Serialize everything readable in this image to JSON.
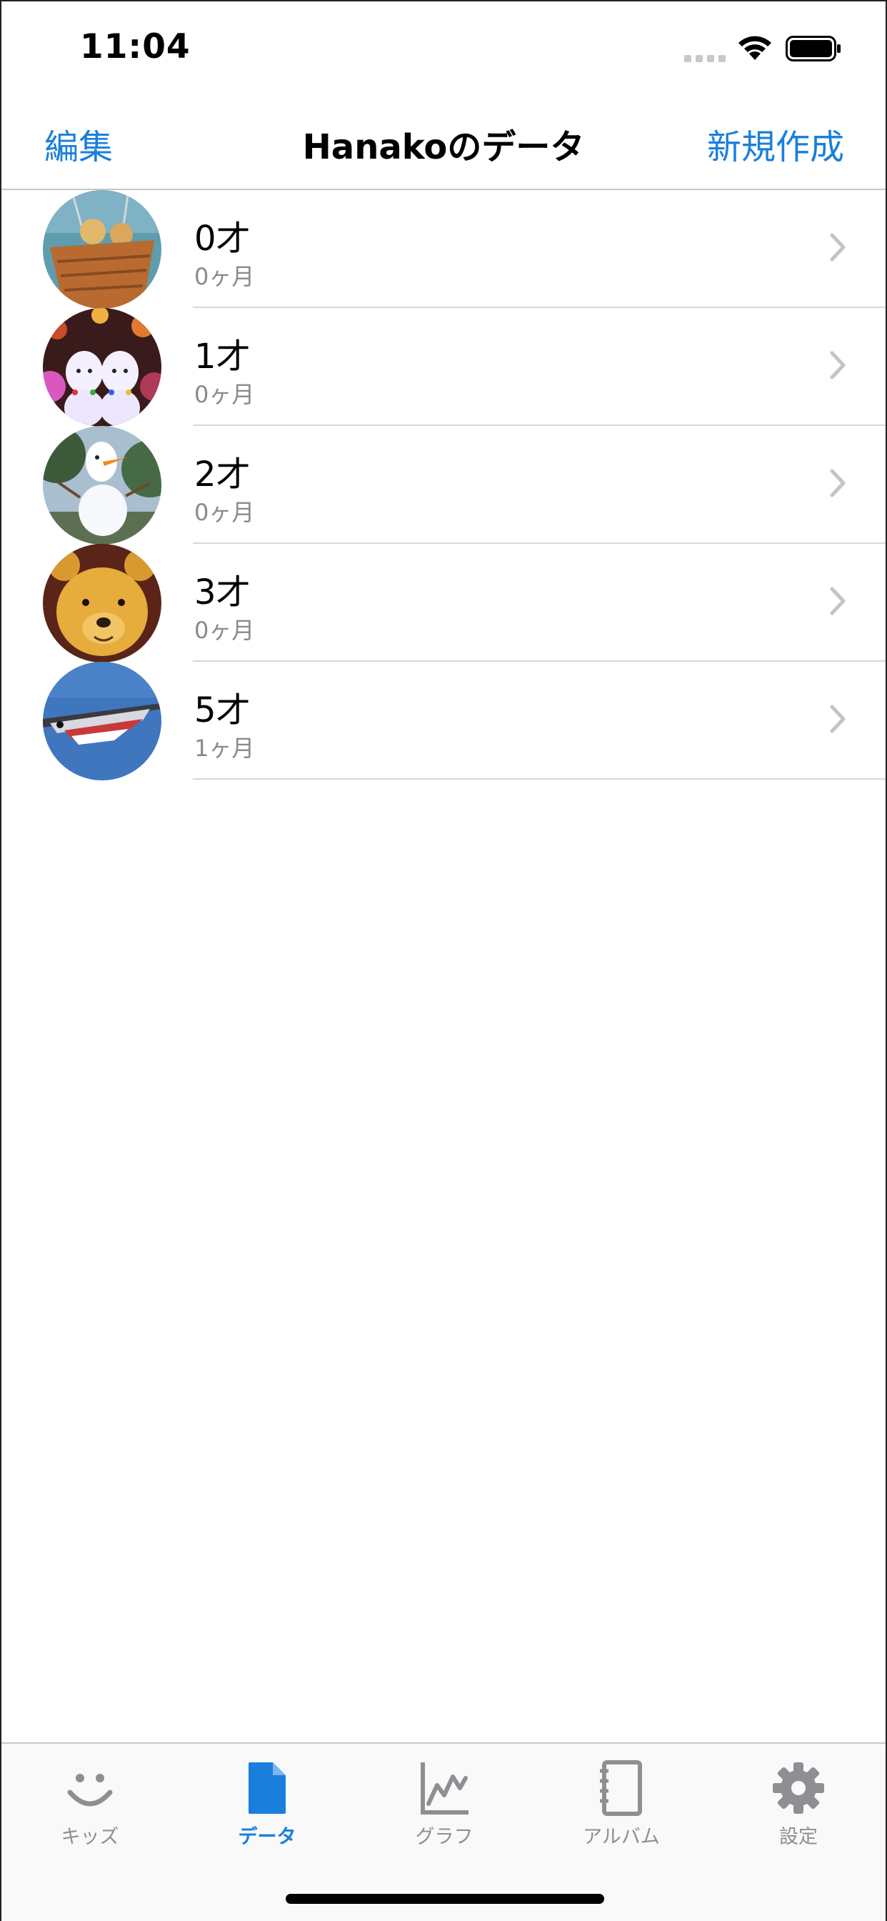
{
  "status_bar": {
    "time": "11:04"
  },
  "nav": {
    "left_label": "編集",
    "title": "Hanakoのデータ",
    "right_label": "新規作成"
  },
  "rows": [
    {
      "title": "0才",
      "subtitle": "0ヶ月"
    },
    {
      "title": "1才",
      "subtitle": "0ヶ月"
    },
    {
      "title": "2才",
      "subtitle": "0ヶ月"
    },
    {
      "title": "3才",
      "subtitle": "0ヶ月"
    },
    {
      "title": "5才",
      "subtitle": "1ヶ月"
    }
  ],
  "tabs": [
    {
      "label": "キッズ",
      "icon": "smiley-face-icon",
      "active": false
    },
    {
      "label": "データ",
      "icon": "document-icon",
      "active": true
    },
    {
      "label": "グラフ",
      "icon": "chart-icon",
      "active": false
    },
    {
      "label": "アルバム",
      "icon": "notebook-icon",
      "active": false
    },
    {
      "label": "設定",
      "icon": "gear-icon",
      "active": false
    }
  ],
  "colors": {
    "accent": "#1a7fdc",
    "inactive": "#8e8e93"
  }
}
